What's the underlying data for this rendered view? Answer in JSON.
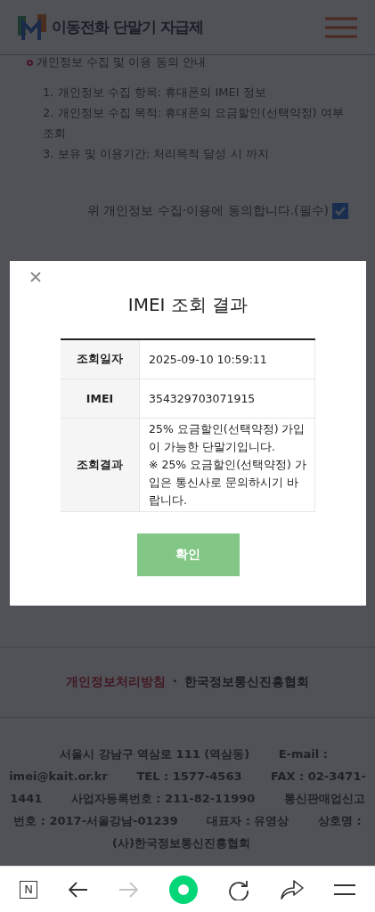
{
  "header": {
    "title": "이동전화 단말기 자급제"
  },
  "consent": {
    "heading": "개인정보 수집 및 이용 동의 안내",
    "items": [
      "1. 개인정보 수집 항목: 휴대폰의 IMEI 정보",
      "2. 개인정보 수집 목적: 휴대폰의 요금할인(선택약정) 여부 조회",
      "3. 보유 및 이용기간: 처리목적 달성 시 까지"
    ],
    "agree_label": "위 개인정보 수집·이용에 동의합니다.(필수)",
    "agree_checked": true
  },
  "modal": {
    "title": "IMEI 조회 결과",
    "rows": [
      {
        "label": "조회일자",
        "value": [
          "2025-09-10 10:59:11"
        ]
      },
      {
        "label": "IMEI",
        "value": [
          "354329703071915"
        ]
      },
      {
        "label": "조회결과",
        "value": [
          "25% 요금할인(선택약정) 가입이 가능한 단말기입니다.",
          "※ 25% 요금할인(선택약정) 가입은 통신사로 문의하시기 바랍니다."
        ]
      }
    ],
    "confirm": "확인"
  },
  "footer": {
    "links": [
      {
        "label": "개인정보처리방침",
        "kind": "privacy"
      },
      {
        "label": "한국정보통신진흥협회",
        "kind": "normal"
      }
    ],
    "separator": "·",
    "info": [
      "서울시 강남구 역삼로 111 (역삼동)",
      "E-mail : imei@kait.or.kr",
      "TEL : 1577-4563",
      "FAX : 02-3471-1441",
      "사업자등록번호 : 211-82-11990",
      "통신판매업신고번호 : 2017-서울강남-01239",
      "대표자 : 유영상",
      "상호명 : (사)한국정보통신진흥협회"
    ]
  },
  "nav": [
    {
      "kind": "naver",
      "label": "N",
      "disabled": false
    },
    {
      "kind": "back",
      "disabled": false
    },
    {
      "kind": "forward",
      "disabled": true
    },
    {
      "kind": "home",
      "disabled": false
    },
    {
      "kind": "refresh",
      "disabled": false
    },
    {
      "kind": "share",
      "disabled": false
    },
    {
      "kind": "menu",
      "disabled": false
    }
  ]
}
